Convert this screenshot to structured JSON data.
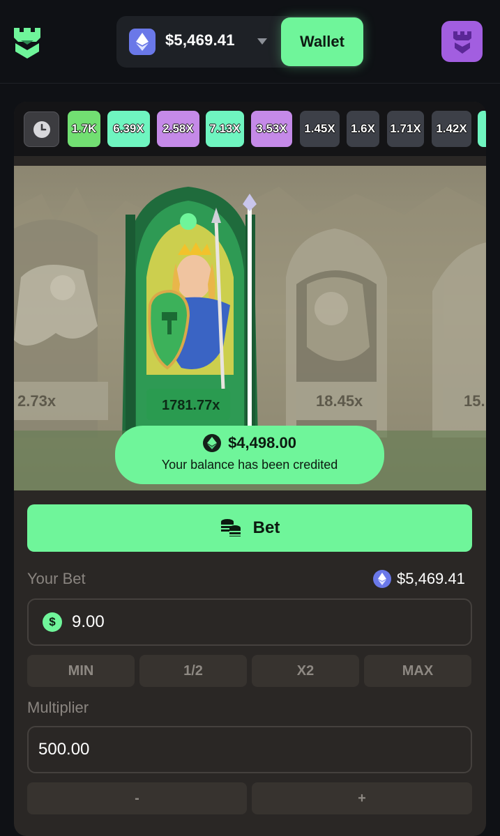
{
  "header": {
    "balance": "$5,469.41",
    "wallet_label": "Wallet",
    "logo_icon": "castle-icon",
    "profile_icon": "tower-icon"
  },
  "history": {
    "icon": "clock-icon",
    "items": [
      {
        "label": "1.7K",
        "color": "#72df72"
      },
      {
        "label": "6.39X",
        "color": "#6ff5c0"
      },
      {
        "label": "2.58X",
        "color": "#c58ae8"
      },
      {
        "label": "7.13X",
        "color": "#6ff5c0"
      },
      {
        "label": "3.53X",
        "color": "#c58ae8"
      },
      {
        "label": "1.45X",
        "color": "#3d4048"
      },
      {
        "label": "1.6X",
        "color": "#3d4048"
      },
      {
        "label": "1.71X",
        "color": "#3d4048"
      },
      {
        "label": "1.42X",
        "color": "#3d4048"
      }
    ]
  },
  "scene": {
    "left_multiplier": "2.73x",
    "center_multiplier": "1781.77x",
    "right_multiplier": "18.45x",
    "far_right_multiplier": "15."
  },
  "toast": {
    "amount": "$4,498.00",
    "message": "Your balance has been credited"
  },
  "controls": {
    "bet_label": "Bet",
    "your_bet_label": "Your Bet",
    "balance": "$5,469.41",
    "bet_value": "9.00",
    "quick_buttons": [
      "MIN",
      "1/2",
      "X2",
      "MAX"
    ],
    "multiplier_label": "Multiplier",
    "multiplier_value": "500.00",
    "minus_label": "-",
    "plus_label": "+"
  },
  "colors": {
    "accent": "#6ff59a",
    "profile": "#a25ee0",
    "eth": "#6a78e8"
  }
}
